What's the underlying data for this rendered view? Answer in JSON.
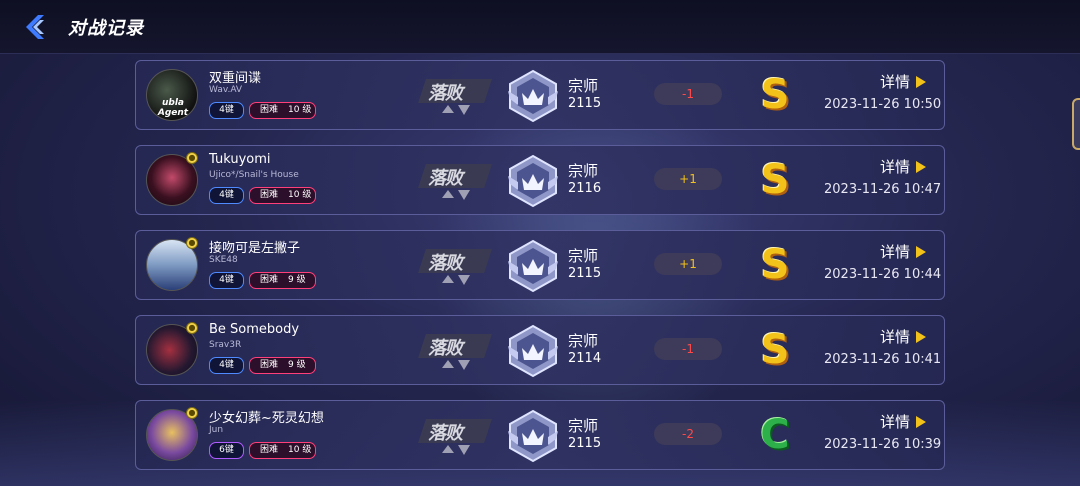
{
  "header": {
    "title": "对战记录"
  },
  "colors": {
    "delta_neg": "#ff4a4a",
    "delta_pos": "#f2c21a"
  },
  "records": [
    {
      "cover_text": "ubla Agent",
      "title": "双重间谍",
      "artist": "Wav.AV",
      "keys": "4键",
      "difficulty": "困难",
      "level": "10 级",
      "result": "落败",
      "rank_name": "宗师",
      "rank_score": "2115",
      "delta": "-1",
      "delta_sign": "neg",
      "grade": "S",
      "grade_icon": "grade-s",
      "details": "详情",
      "timestamp": "2023-11-26 10:50"
    },
    {
      "cover_text": "",
      "title": "Tukuyomi",
      "artist": "Ujico*/Snail's House",
      "keys": "4键",
      "difficulty": "困难",
      "level": "10 级",
      "result": "落败",
      "rank_name": "宗师",
      "rank_score": "2116",
      "delta": "+1",
      "delta_sign": "pos",
      "grade": "S",
      "grade_icon": "grade-s",
      "details": "详情",
      "timestamp": "2023-11-26 10:47"
    },
    {
      "cover_text": "",
      "title": "接吻可是左撇子",
      "artist": "SKE48",
      "keys": "4键",
      "difficulty": "困难",
      "level": "9 级",
      "result": "落败",
      "rank_name": "宗师",
      "rank_score": "2115",
      "delta": "+1",
      "delta_sign": "pos",
      "grade": "S",
      "grade_icon": "grade-s",
      "details": "详情",
      "timestamp": "2023-11-26 10:44"
    },
    {
      "cover_text": "",
      "title": "Be Somebody",
      "artist": "Srav3R",
      "keys": "4键",
      "difficulty": "困难",
      "level": "9 级",
      "result": "落败",
      "rank_name": "宗师",
      "rank_score": "2114",
      "delta": "-1",
      "delta_sign": "neg",
      "grade": "S",
      "grade_icon": "grade-s",
      "details": "详情",
      "timestamp": "2023-11-26 10:41"
    },
    {
      "cover_text": "",
      "title": "少女幻葬~死灵幻想",
      "artist": "Jun",
      "keys": "6键",
      "difficulty": "困难",
      "level": "10 级",
      "result": "落败",
      "rank_name": "宗师",
      "rank_score": "2115",
      "delta": "-2",
      "delta_sign": "neg",
      "grade": "C",
      "grade_icon": "grade-c",
      "details": "详情",
      "timestamp": "2023-11-26 10:39"
    }
  ]
}
